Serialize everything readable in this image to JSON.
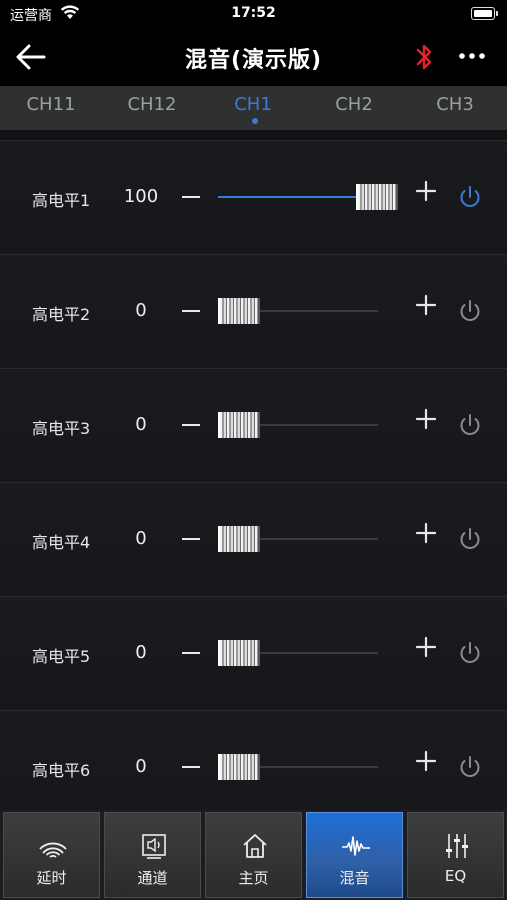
{
  "status_bar": {
    "carrier": "运营商",
    "time": "17:52"
  },
  "nav": {
    "title": "混音(演示版)"
  },
  "channels": {
    "tabs": [
      {
        "label": "CH11",
        "active": false
      },
      {
        "label": "CH12",
        "active": false
      },
      {
        "label": "CH1",
        "active": true
      },
      {
        "label": "CH2",
        "active": false
      },
      {
        "label": "CH3",
        "active": false
      }
    ]
  },
  "mix_rows": [
    {
      "label": "高电平1",
      "value": "100",
      "level": 1.0,
      "enabled": true
    },
    {
      "label": "高电平2",
      "value": "0",
      "level": 0.0,
      "enabled": false
    },
    {
      "label": "高电平3",
      "value": "0",
      "level": 0.0,
      "enabled": false
    },
    {
      "label": "高电平4",
      "value": "0",
      "level": 0.0,
      "enabled": false
    },
    {
      "label": "高电平5",
      "value": "0",
      "level": 0.0,
      "enabled": false
    },
    {
      "label": "高电平6",
      "value": "0",
      "level": 0.0,
      "enabled": false
    }
  ],
  "bottom_tabs": [
    {
      "label": "延时",
      "icon": "signal-waves-icon",
      "active": false
    },
    {
      "label": "通道",
      "icon": "speaker-icon",
      "active": false
    },
    {
      "label": "主页",
      "icon": "home-icon",
      "active": false
    },
    {
      "label": "混音",
      "icon": "waveform-icon",
      "active": true
    },
    {
      "label": "EQ",
      "icon": "eq-sliders-icon",
      "active": false
    }
  ],
  "colors": {
    "accent": "#3a7ad8",
    "bluetooth": "#e0252a",
    "tab_bar_bg": "#2f3130"
  }
}
